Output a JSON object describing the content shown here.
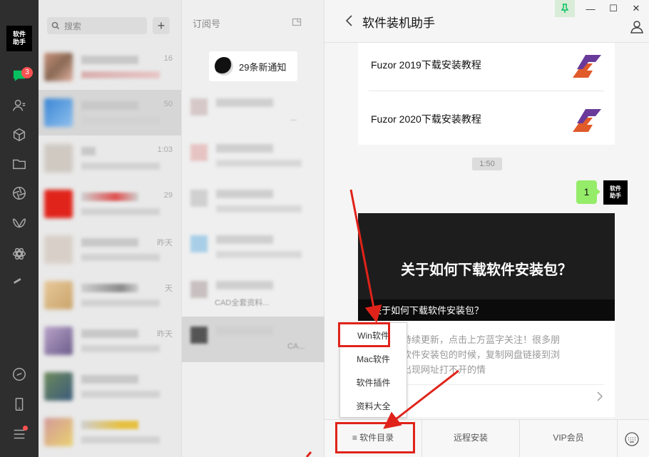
{
  "rail": {
    "logo_text_1": "软件",
    "logo_text_2": "助手",
    "chat_badge": "3"
  },
  "chatlist": {
    "search_placeholder": "搜索",
    "add_label": "+",
    "rows": [
      {
        "time": "16"
      },
      {
        "time": "50"
      },
      {
        "time": "1:03"
      },
      {
        "time": "29"
      },
      {
        "time": "昨天"
      },
      {
        "time": "天"
      },
      {
        "time": "昨天"
      },
      {
        "time": ""
      },
      {
        "time": ""
      }
    ]
  },
  "subs": {
    "title": "订阅号",
    "notice": "29条新通知",
    "rows": [
      {
        "text": "..."
      },
      {
        "text": ""
      },
      {
        "text": ""
      },
      {
        "text": ""
      },
      {
        "text": "CAD全套资料..."
      },
      {
        "text": "CA..."
      }
    ]
  },
  "conversation": {
    "title": "软件装机助手",
    "articles": [
      {
        "title": "Fuzor 2019下载安装教程"
      },
      {
        "title": "Fuzor 2020下载安装教程"
      }
    ],
    "timestamp": "1:50",
    "my_message": "1",
    "my_avatar_1": "软件",
    "my_avatar_2": "助手",
    "card": {
      "cover_title": "关于如何下载软件安装包？",
      "cover_caption": "关于如何下载软件安装包？",
      "desc_line1": "持续更新，点击上方蓝字关注！很多朋",
      "desc_line2": "友软件安装包的时候，复制网盘链接到浏",
      "desc_line3": "出现网址打不开的情"
    },
    "menu": {
      "items": [
        "≡ 软件目录",
        "远程安装",
        "VIP会员"
      ]
    },
    "popup": {
      "items": [
        "Win软件",
        "Mac软件",
        "软件插件",
        "资料大全"
      ]
    }
  },
  "window": {
    "minimize": "—",
    "maximize": "☐",
    "close": "✕"
  },
  "colors": {
    "accent_green": "#07c160",
    "bubble_green": "#95ec69",
    "annotation_red": "#e0231a",
    "badge_red": "#fa5151"
  }
}
